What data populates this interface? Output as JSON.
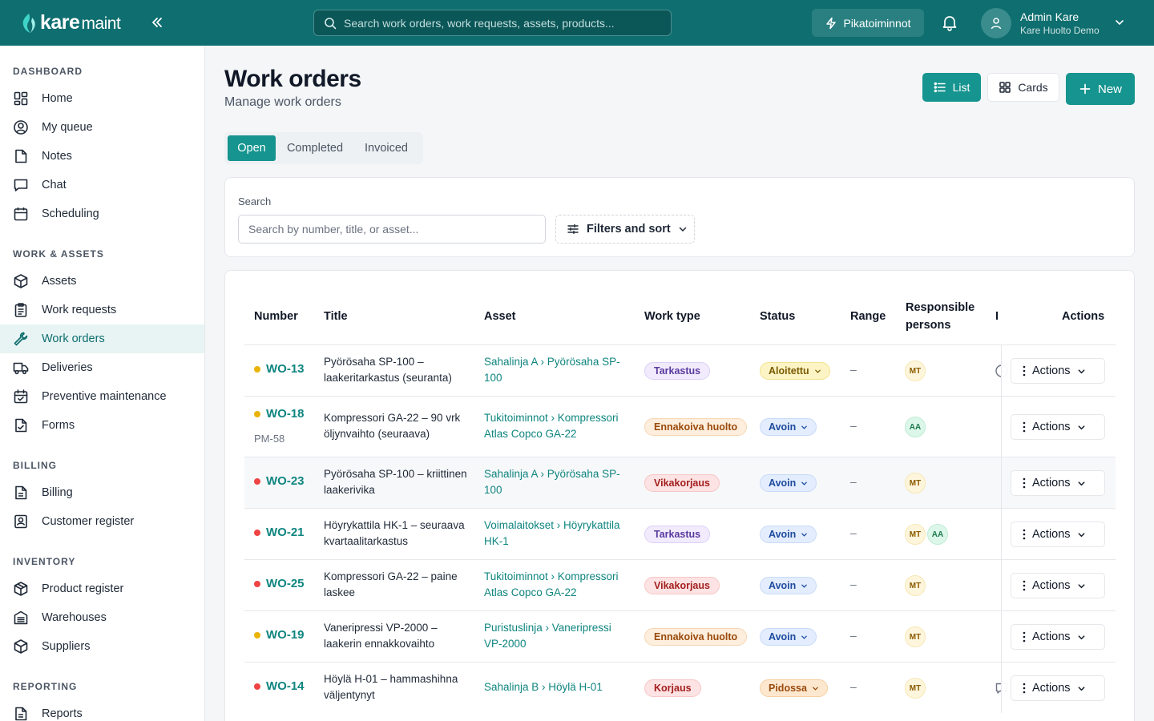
{
  "brand": {
    "name_bold": "kare",
    "name_thin": "maint",
    "accent": "#0f6e6f",
    "primary": "#16948f"
  },
  "topbar": {
    "search_placeholder": "Search work orders, work requests, assets, products...",
    "quick_actions": "Pikatoiminnot",
    "user_name": "Admin Kare",
    "user_org": "Kare Huolto Demo"
  },
  "sidebar": {
    "sections": [
      {
        "title": "DASHBOARD",
        "items": [
          "Home",
          "My queue",
          "Notes",
          "Chat",
          "Scheduling"
        ]
      },
      {
        "title": "WORK & ASSETS",
        "items": [
          "Assets",
          "Work requests",
          "Work orders",
          "Deliveries",
          "Preventive maintenance",
          "Forms"
        ]
      },
      {
        "title": "BILLING",
        "items": [
          "Billing",
          "Customer register"
        ]
      },
      {
        "title": "INVENTORY",
        "items": [
          "Product register",
          "Warehouses",
          "Suppliers"
        ]
      },
      {
        "title": "REPORTING",
        "items": [
          "Reports"
        ]
      }
    ],
    "active": "Work orders"
  },
  "page": {
    "title": "Work orders",
    "subtitle": "Manage work orders",
    "view_list": "List",
    "view_cards": "Cards",
    "new_label": "New"
  },
  "tabs": [
    "Open",
    "Completed",
    "Invoiced"
  ],
  "search": {
    "label": "Search",
    "placeholder": "Search by number, title, or asset...",
    "filters_label": "Filters and sort"
  },
  "table": {
    "headers": {
      "number": "Number",
      "title": "Title",
      "asset": "Asset",
      "work_type": "Work type",
      "status": "Status",
      "range": "Range",
      "responsible_1": "Responsible",
      "responsible_2": "persons",
      "truncated": "I",
      "actions": "Actions"
    },
    "rows": [
      {
        "number": "WO-13",
        "priority_color": "#eab308",
        "ref": "",
        "title": [
          "Pyörösaha SP-100 –",
          "laakeritarkastus (seuranta)"
        ],
        "asset": "Sahalinja A › Pyörösaha SP-100",
        "work_type": "Tarkastus",
        "status": "Aloitettu",
        "range": "–",
        "persons": [
          "MT"
        ],
        "icon": "clock-icon",
        "actions": "Actions"
      },
      {
        "number": "WO-18",
        "priority_color": "#eab308",
        "ref": "PM-58",
        "title": [
          "Kompressori GA-22 – 90 vrk",
          "öljynvaihto (seuraava)"
        ],
        "asset": "Tukitoiminnot › Kompressori Atlas Copco GA-22",
        "work_type": "Ennakoiva huolto",
        "status": "Avoin",
        "range": "–",
        "persons": [
          "AA"
        ],
        "icon": "",
        "actions": "Actions"
      },
      {
        "number": "WO-23",
        "priority_color": "#ef4444",
        "ref": "",
        "title": [
          "Pyörösaha SP-100 – kriittinen",
          "laakerivika"
        ],
        "asset": "Sahalinja A › Pyörösaha SP-100",
        "work_type": "Vikakorjaus",
        "status": "Avoin",
        "range": "–",
        "persons": [
          "MT"
        ],
        "icon": "",
        "actions": "Actions"
      },
      {
        "number": "WO-21",
        "priority_color": "#ef4444",
        "ref": "",
        "title": [
          "Höyrykattila HK-1 – seuraava",
          "kvartaalitarkastus"
        ],
        "asset": "Voimalaitokset › Höyrykattila HK-1",
        "work_type": "Tarkastus",
        "status": "Avoin",
        "range": "–",
        "persons": [
          "MT",
          "AA"
        ],
        "icon": "",
        "actions": "Actions"
      },
      {
        "number": "WO-25",
        "priority_color": "#ef4444",
        "ref": "",
        "title": [
          "Kompressori GA-22 – paine",
          "laskee"
        ],
        "asset": "Tukitoiminnot › Kompressori Atlas Copco GA-22",
        "work_type": "Vikakorjaus",
        "status": "Avoin",
        "range": "–",
        "persons": [
          "MT"
        ],
        "icon": "",
        "actions": "Actions"
      },
      {
        "number": "WO-19",
        "priority_color": "#eab308",
        "ref": "",
        "title": [
          "Vaneripressi VP-2000 –",
          "laakerin ennakkovaihto"
        ],
        "asset": "Puristuslinja › Vaneripressi VP-2000",
        "work_type": "Ennakoiva huolto",
        "status": "Avoin",
        "range": "–",
        "persons": [
          "MT"
        ],
        "icon": "",
        "actions": "Actions"
      },
      {
        "number": "WO-14",
        "priority_color": "#ef4444",
        "ref": "",
        "title": [
          "Höylä H-01 – hammashihna",
          "väljentynyt"
        ],
        "asset": "Sahalinja B › Höylä H-01",
        "work_type": "Korjaus",
        "status": "Pidossa",
        "range": "–",
        "persons": [
          "MT"
        ],
        "icon": "comment-icon",
        "actions": "Actions"
      }
    ]
  }
}
